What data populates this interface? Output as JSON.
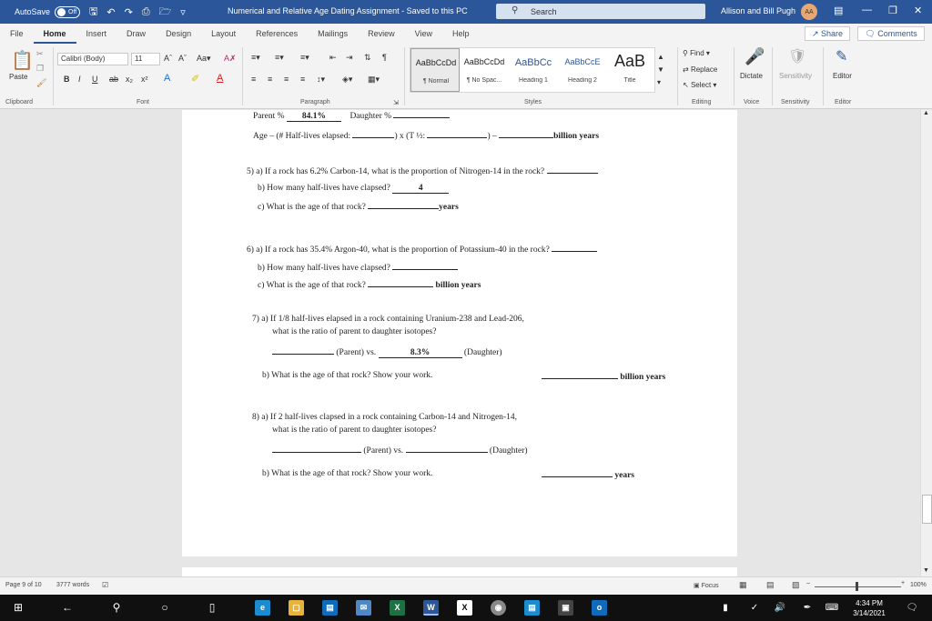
{
  "titlebar": {
    "autosave_label": "AutoSave",
    "autosave_state": "Off",
    "doc_title": "Numerical and Relative Age Dating Assignment  -  Saved to this PC",
    "search_placeholder": "Search",
    "user_name": "Allison and Bill Pugh",
    "user_initials": "AA",
    "bar_color": "#2b579a"
  },
  "tabs": [
    "File",
    "Home",
    "Insert",
    "Draw",
    "Design",
    "Layout",
    "References",
    "Mailings",
    "Review",
    "View",
    "Help"
  ],
  "active_tab": "Home",
  "share_label": "Share",
  "comments_label": "Comments",
  "ribbon": {
    "paste_label": "Paste",
    "font_name": "Calibri (Body)",
    "font_size": "11",
    "groups": {
      "clipboard": "Clipboard",
      "font": "Font",
      "paragraph": "Paragraph",
      "styles": "Styles",
      "editing": "Editing",
      "voice": "Voice",
      "sensitivity": "Sensitivity",
      "editor": "Editor"
    },
    "styles": [
      {
        "sample": "AaBbCcDd",
        "name": "¶ Normal"
      },
      {
        "sample": "AaBbCcDd",
        "name": "¶ No Spac..."
      },
      {
        "sample": "AaBbCc",
        "name": "Heading 1"
      },
      {
        "sample": "AaBbCcE",
        "name": "Heading 2"
      },
      {
        "sample": "AaB",
        "name": "Title"
      }
    ],
    "find_label": "Find",
    "replace_label": "Replace",
    "select_label": "Select",
    "dictate_label": "Dictate",
    "sensitivity_label": "Sensitivity",
    "editor_label": "Editor"
  },
  "document": {
    "line1_parent": "Parent %",
    "line1_parent_value": "84.1%",
    "line1_daughter": "Daughter %",
    "line2_age": "Age – (# Half-lives elapsed:",
    "line2_mid": ") x (T ½:",
    "line2_end": ") –",
    "line2_unit": "billion years",
    "q5a": "5) a) If a rock has 6.2% Carbon-14, what is the proportion of Nitrogen-14 in the rock?",
    "q5b": "b) How many half-lives have clapsed?",
    "q5b_answer": "4",
    "q5c": "c) What is the age of that rock?",
    "q5c_unit": "years",
    "q6a": "6) a) If a rock has 35.4% Argon-40, what is the proportion of Potassium-40 in the rock?",
    "q6b": "b) How many half-lives have clapsed?",
    "q6c": "c) What is the age of that rock?",
    "q6c_unit": "billion years",
    "q7a_1": "7) a) If 1/8 half-lives elapsed in a rock containing Uranium-238 and Lead-206,",
    "q7a_2": "what is the ratio of parent to daughter isotopes?",
    "q7_parent": "(Parent) vs.",
    "q7_daughter_value": "8.3%",
    "q7_daughter": "(Daughter)",
    "q7b": "b) What is the age of that rock?  Show your work.",
    "q7b_unit": "billion years",
    "q8a_1": "8) a) If 2 half-lives clapsed in a rock containing Carbon-14 and Nitrogen-14,",
    "q8a_2": "what is the ratio of parent to daughter isotopes?",
    "q8_parent": "(Parent) vs.",
    "q8_daughter": "(Daughter)",
    "q8b": "b) What is the age of that rock?  Show your work.",
    "q8b_unit": "years"
  },
  "statusbar": {
    "page": "Page 9 of 10",
    "words": "3777 words",
    "focus": "Focus",
    "zoom": "100%"
  },
  "taskbar": {
    "time": "4:34 PM",
    "date": "3/14/2021",
    "notification_count": "7"
  }
}
